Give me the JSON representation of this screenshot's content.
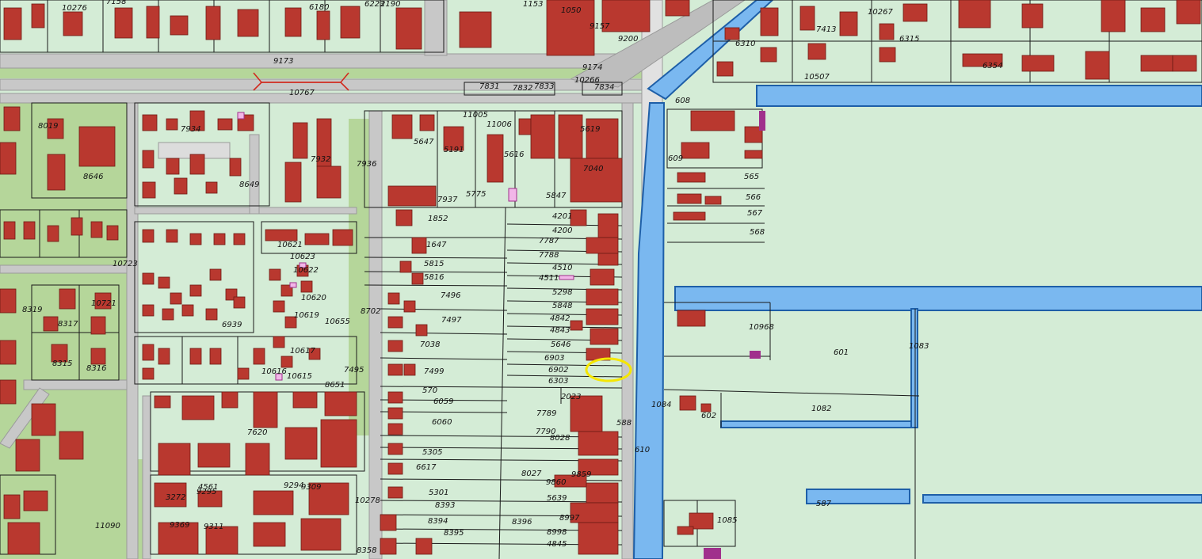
{
  "map": {
    "colors": {
      "parcel_fill": "#d4ecd6",
      "parcel_line": "#1a1a1a",
      "building": "#b9382f",
      "water": "#7ab8f0",
      "water_edge": "#1e5fa8",
      "road": "#c8c8c8",
      "road_dark": "#a9a9a9",
      "green_strip": "#b5d69a",
      "highlight_circle": "#f5e600",
      "special_parcel": "#a0308c"
    },
    "labels": [
      "10276",
      "7158",
      "6180",
      "6223",
      "2190",
      "1153",
      "1050",
      "9157",
      "9200",
      "10267",
      "6315",
      "6310",
      "7413",
      "6354",
      "9173",
      "9174",
      "10266",
      "10507",
      "7934",
      "10767",
      "7831",
      "7832",
      "7833",
      "7834",
      "608",
      "8019",
      "8646",
      "8649",
      "7936",
      "7932",
      "11005",
      "11006",
      "5647",
      "5191",
      "5616",
      "5619",
      "7040",
      "609",
      "565",
      "566",
      "567",
      "568",
      "5775",
      "5847",
      "7937",
      "1852",
      "1647",
      "5815",
      "5816",
      "7496",
      "7497",
      "7038",
      "7499",
      "4201",
      "4200",
      "7787",
      "7788",
      "4510",
      "4511",
      "5298",
      "5848",
      "4842",
      "4843",
      "5646",
      "6903",
      "6902",
      "6303",
      "10621",
      "10622",
      "10623",
      "10620",
      "10619",
      "10655",
      "10617",
      "10616",
      "10615",
      "6939",
      "10723",
      "10721",
      "8317",
      "8315",
      "8316",
      "8319",
      "8702",
      "7495",
      "8651",
      "7620",
      "11090",
      "10968",
      "601",
      "1083",
      "1082",
      "1084",
      "602",
      "610",
      "588",
      "587",
      "1085",
      "570",
      "6059",
      "6060",
      "5305",
      "6617",
      "2023",
      "7789",
      "7790",
      "8028",
      "8027",
      "9859",
      "9860",
      "5639",
      "5301",
      "8393",
      "8394",
      "8395",
      "8396",
      "8997",
      "8998",
      "4845",
      "4561",
      "9295",
      "9294",
      "9309",
      "9311",
      "9369",
      "8358",
      "10278",
      "3272"
    ]
  }
}
